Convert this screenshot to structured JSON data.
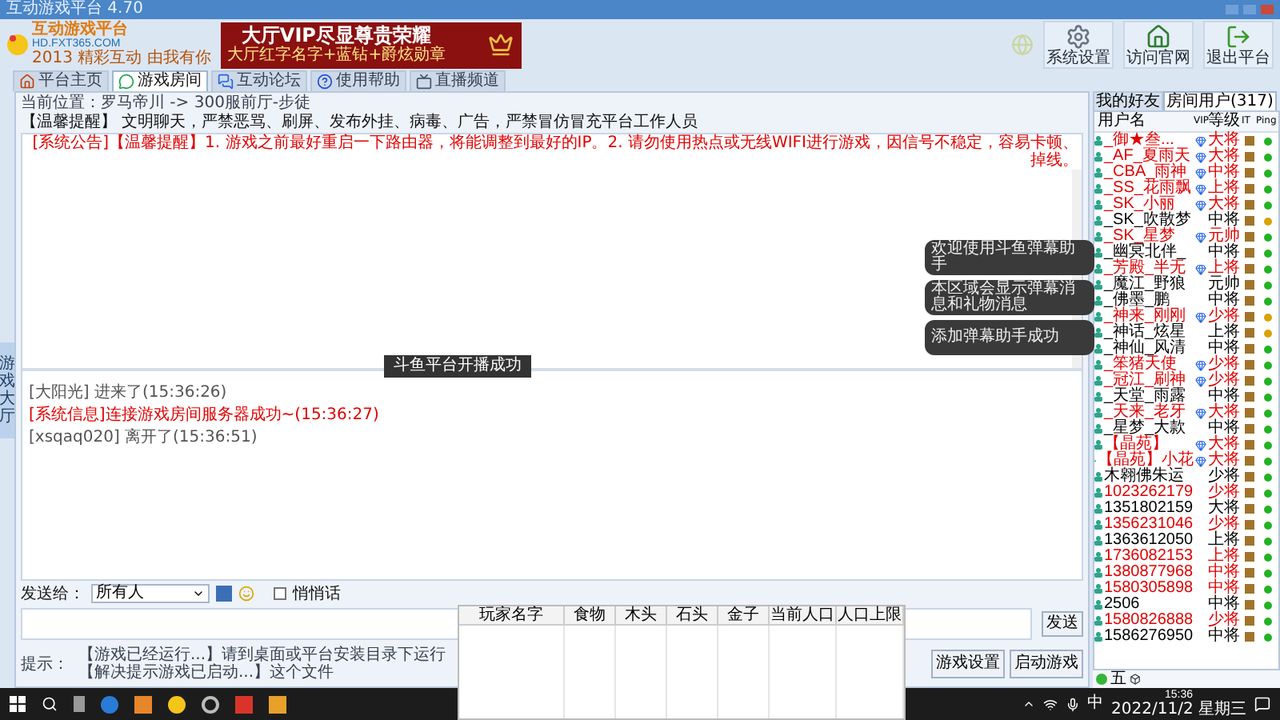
{
  "window": {
    "title": "互动游戏平台 4.70"
  },
  "logo": {
    "name": "互动游戏平台",
    "url": "HD.FXT365.COM",
    "slogan": "2013 精彩互动 由我有你"
  },
  "banner": {
    "headline": "大厅VIP尽显尊贵荣耀",
    "subline": "大厅红字名字+蓝钻+爵炫勋章"
  },
  "toolbar": [
    {
      "label": "系统设置",
      "kind": "gear"
    },
    {
      "label": "访问官网",
      "kind": "house"
    },
    {
      "label": "退出平台",
      "kind": "exit"
    }
  ],
  "tabs": [
    {
      "label": "平台主页",
      "kind": "home",
      "selected": false
    },
    {
      "label": "游戏房间",
      "kind": "chat",
      "selected": true
    },
    {
      "label": "互动论坛",
      "kind": "forum",
      "selected": false
    },
    {
      "label": "使用帮助",
      "kind": "help",
      "selected": false
    },
    {
      "label": "直播频道",
      "kind": "tv",
      "selected": false
    }
  ],
  "breadcrumb": "当前位置：罗马帝川 -> 300服前厅-步徒",
  "notice": "【温馨提醒】 文明聊天，严禁恶骂、刷屏、发布外挂、病毒、广告，严禁冒仿冒充平台工作人员",
  "announcement": "[系统公告]【温馨提醒】1. 游戏之前最好重启一下路由器，将能调整到最好的IP。2. 请勿使用热点或无线WIFI进行游戏，因信号不稳定，容易卡顿、掉线。",
  "side_tab": "游戏大厅",
  "game_toast": "斗鱼平台开播成功",
  "chat": [
    {
      "text": "[大阳光] 进来了(15:36:26)",
      "kind": "info"
    },
    {
      "text": "[系统信息]连接游戏房间服务器成功~(15:36:27)",
      "kind": "system"
    },
    {
      "text": "[xsqaq020] 离开了(15:36:51)",
      "kind": "info"
    }
  ],
  "send": {
    "label": "发送给：",
    "recipient": "所有人",
    "whisper": {
      "label": "悄悄话",
      "checked": false
    },
    "button": "发送"
  },
  "tip": {
    "label": "提示：",
    "text": "【游戏已经运行...】请到桌面或平台安装目录下运行【解决提示游戏已启动...】这个文件"
  },
  "buttons": [
    "游戏设置",
    "启动游戏"
  ],
  "user_panel": {
    "tabs": [
      {
        "label": "我的好友",
        "selected": false
      },
      {
        "label": "房间用户(317)",
        "selected": true
      }
    ],
    "columns": [
      "用户名",
      "VIP",
      "等级",
      "IT",
      "Ping"
    ],
    "users": [
      {
        "name": "_御★叁...",
        "color": "#e00000",
        "vip": true,
        "level": "大将",
        "ping": {
          "color": "#22b322"
        }
      },
      {
        "name": "_AF_夏雨天",
        "color": "#e00000",
        "vip": true,
        "level": "大将",
        "ping": {
          "color": "#22b322"
        }
      },
      {
        "name": "_CBA_雨神",
        "color": "#e00000",
        "vip": true,
        "level": "中将",
        "ping": {
          "color": "#22b322"
        }
      },
      {
        "name": "_SS_花雨飘",
        "color": "#e00000",
        "vip": true,
        "level": "上将",
        "ping": {
          "color": "#22b322"
        }
      },
      {
        "name": "_SK_小丽",
        "color": "#e00000",
        "vip": true,
        "level": "大将",
        "ping": {
          "color": "#22b322"
        }
      },
      {
        "name": "_SK_吹散梦",
        "color": "#000000",
        "vip": false,
        "level": "中将",
        "ping": {
          "color": "#d9a400"
        }
      },
      {
        "name": "_SK_星梦",
        "color": "#e00000",
        "vip": true,
        "level": "元帅",
        "ping": {
          "color": "#22b322"
        }
      },
      {
        "name": "_幽冥北伴_",
        "color": "#000000",
        "vip": false,
        "level": "中将",
        "ping": {
          "color": "#22b322"
        }
      },
      {
        "name": "_芳殿_半无",
        "color": "#e00000",
        "vip": true,
        "level": "上将",
        "ping": {
          "color": "#22b322"
        }
      },
      {
        "name": "_魔江_野狼",
        "color": "#000000",
        "vip": false,
        "level": "元帅",
        "ping": {
          "color": "#22b322"
        }
      },
      {
        "name": "_佛墨_鹏",
        "color": "#000000",
        "vip": false,
        "level": "中将",
        "ping": {
          "color": "#22b322"
        }
      },
      {
        "name": "_神来_刚刚",
        "color": "#e00000",
        "vip": true,
        "level": "少将",
        "ping": {
          "color": "#d9a400"
        }
      },
      {
        "name": "_神话_炫星",
        "color": "#000000",
        "vip": false,
        "level": "上将",
        "ping": {
          "color": "#d9a400"
        }
      },
      {
        "name": "_神仙_风清",
        "color": "#000000",
        "vip": false,
        "level": "中将",
        "ping": {
          "color": "#22b322"
        }
      },
      {
        "name": "_笨猪天使",
        "color": "#e00000",
        "vip": true,
        "level": "少将",
        "ping": {
          "color": "#22b322"
        }
      },
      {
        "name": "_冠江_刷神",
        "color": "#e00000",
        "vip": true,
        "level": "少将",
        "ping": {
          "color": "#22b322"
        }
      },
      {
        "name": "_天堂_雨露",
        "color": "#000000",
        "vip": false,
        "level": "中将",
        "ping": {
          "color": "#22b322"
        }
      },
      {
        "name": "_天来_老牙",
        "color": "#e00000",
        "vip": true,
        "level": "大将",
        "ping": {
          "color": "#22b322"
        }
      },
      {
        "name": "_星梦_大款",
        "color": "#000000",
        "vip": false,
        "level": "中将",
        "ping": {
          "color": "#22b322"
        }
      },
      {
        "name": "【晶苑】",
        "color": "#e00000",
        "vip": true,
        "level": "大将",
        "ping": {
          "color": "#22b322"
        }
      },
      {
        "name": "【晶苑】小花",
        "color": "#e00000",
        "vip": true,
        "level": "大将",
        "ping": {
          "color": "#22b322"
        }
      },
      {
        "name": "木翱佛朱运",
        "color": "#000000",
        "vip": false,
        "level": "少将",
        "ping": {
          "color": "#22b322"
        }
      },
      {
        "name": "1023262179",
        "color": "#e00000",
        "vip": false,
        "level": "少将",
        "ping": {
          "color": "#22b322"
        }
      },
      {
        "name": "1351802159",
        "color": "#000000",
        "vip": false,
        "level": "大将",
        "ping": {
          "color": "#22b322"
        }
      },
      {
        "name": "1356231046",
        "color": "#e00000",
        "vip": false,
        "level": "少将",
        "ping": {
          "color": "#22b322"
        }
      },
      {
        "name": "1363612050",
        "color": "#000000",
        "vip": false,
        "level": "上将",
        "ping": {
          "color": "#22b322"
        }
      },
      {
        "name": "1736082153",
        "color": "#e00000",
        "vip": false,
        "level": "上将",
        "ping": {
          "color": "#22b322"
        }
      },
      {
        "name": "1380877968",
        "color": "#e00000",
        "vip": false,
        "level": "中将",
        "ping": {
          "color": "#22b322"
        }
      },
      {
        "name": "1580305898",
        "color": "#e00000",
        "vip": false,
        "level": "中将",
        "ping": {
          "color": "#22b322"
        }
      },
      {
        "name": "2506",
        "color": "#000000",
        "vip": false,
        "level": "中将",
        "ping": {
          "color": "#22b322"
        }
      },
      {
        "name": "1580826888",
        "color": "#e00000",
        "vip": false,
        "level": "少将",
        "ping": {
          "color": "#22b322"
        }
      },
      {
        "name": "1586276950",
        "color": "#000000",
        "vip": false,
        "level": "中将",
        "ping": {
          "color": "#22b322"
        }
      }
    ]
  },
  "ime_bar": "五",
  "notifications": [
    "欢迎使用斗鱼弹幕助手",
    "本区域会显示弹幕消息和礼物消息",
    "添加弹幕助手成功"
  ],
  "sheet": {
    "columns": [
      "玩家名字",
      "食物",
      "木头",
      "石头",
      "金子",
      "当前人口",
      "人口上限"
    ]
  },
  "taskbar": {
    "ime": "中",
    "time": "15:36",
    "date": "2022/11/2 星期三"
  }
}
